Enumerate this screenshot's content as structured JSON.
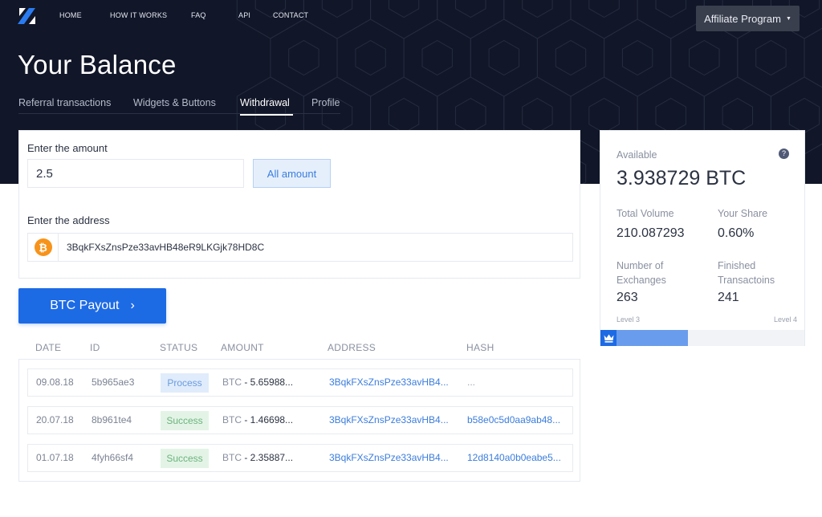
{
  "nav": {
    "items": [
      "HOME",
      "HOW IT WORKS",
      "FAQ",
      "API",
      "CONTACT"
    ],
    "affiliate_label": "Affiliate Program",
    "affiliate_caret": "▼"
  },
  "header": {
    "title": "Your Balance",
    "tabs": [
      {
        "label": "Referral transactions",
        "active": false
      },
      {
        "label": "Widgets & Buttons",
        "active": false
      },
      {
        "label": "Withdrawal",
        "active": true
      },
      {
        "label": "Profile",
        "active": false
      }
    ]
  },
  "withdraw_form": {
    "amount_label": "Enter the amount",
    "amount_value": "2.5",
    "all_amount_label": "All amount",
    "address_label": "Enter the address",
    "address_value": "3BqkFXsZnsPze33avHB48eR9LKGjk78HD8C",
    "coin_icon": "bitcoin-icon",
    "coin_symbol": "₿",
    "payout_label": "BTC Payout",
    "payout_chevron": "›"
  },
  "table": {
    "headers": {
      "date": "DATE",
      "id": "ID",
      "status": "STATUS",
      "amount": "AMOUNT",
      "address": "ADDRESS",
      "hash": "HASH"
    },
    "rows": [
      {
        "date": "09.08.18",
        "id": "5b965ae3",
        "status": "Process",
        "currency": "BTC",
        "amount": " - 5.65988...",
        "address": "3BqkFXsZnsPze33avHB4...",
        "hash": "..."
      },
      {
        "date": "20.07.18",
        "id": "8b961te4",
        "status": "Success",
        "currency": "BTC",
        "amount": " - 1.46698...",
        "address": "3BqkFXsZnsPze33avHB4...",
        "hash": "b58e0c5d0aa9ab48..."
      },
      {
        "date": "01.07.18",
        "id": "4fyh66sf4",
        "status": "Success",
        "currency": "BTC",
        "amount": " - 2.35887...",
        "address": "3BqkFXsZnsPze33avHB4...",
        "hash": "12d8140a0b0eabe5..."
      }
    ]
  },
  "stats": {
    "available_label": "Available",
    "available_value": "3.938729 BTC",
    "help_symbol": "?",
    "total_volume_label": "Total Volume",
    "total_volume_value": "210.087293",
    "your_share_label": "Your Share",
    "your_share_value": "0.60%",
    "exchanges_label": "Number of Exchanges",
    "exchanges_value": "263",
    "finished_label": "Finished Transactoins",
    "finished_value": "241",
    "level_current": "Level 3",
    "level_next": "Level 4",
    "level_progress": 0.43
  },
  "colors": {
    "hero_bg": "#111628",
    "accent_blue": "#1d6ae5",
    "link_blue": "#3b7ddd",
    "bitcoin_orange": "#f7931a",
    "success_green": "#6cb37d",
    "process_blue": "#6b9be0"
  }
}
